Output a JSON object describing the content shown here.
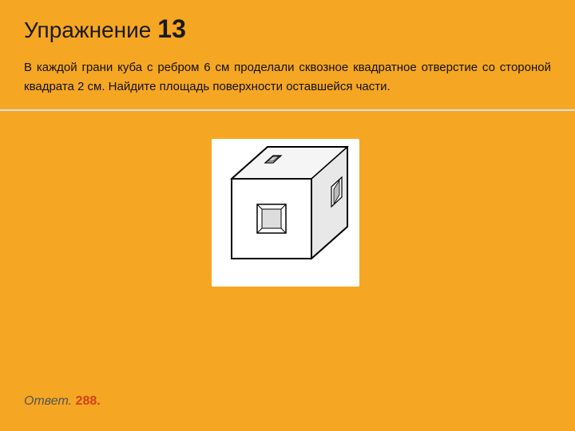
{
  "page": {
    "background_color": "#F5A623"
  },
  "title": {
    "prefix": "Упражнение",
    "number": "13"
  },
  "problem": {
    "text": "В каждой грани куба с ребром 6 см проделали сквозное квадратное отверстие со стороной квадрата 2 см. Найдите площадь поверхности оставшейся части."
  },
  "answer": {
    "label": "Ответ.",
    "value": "288."
  }
}
